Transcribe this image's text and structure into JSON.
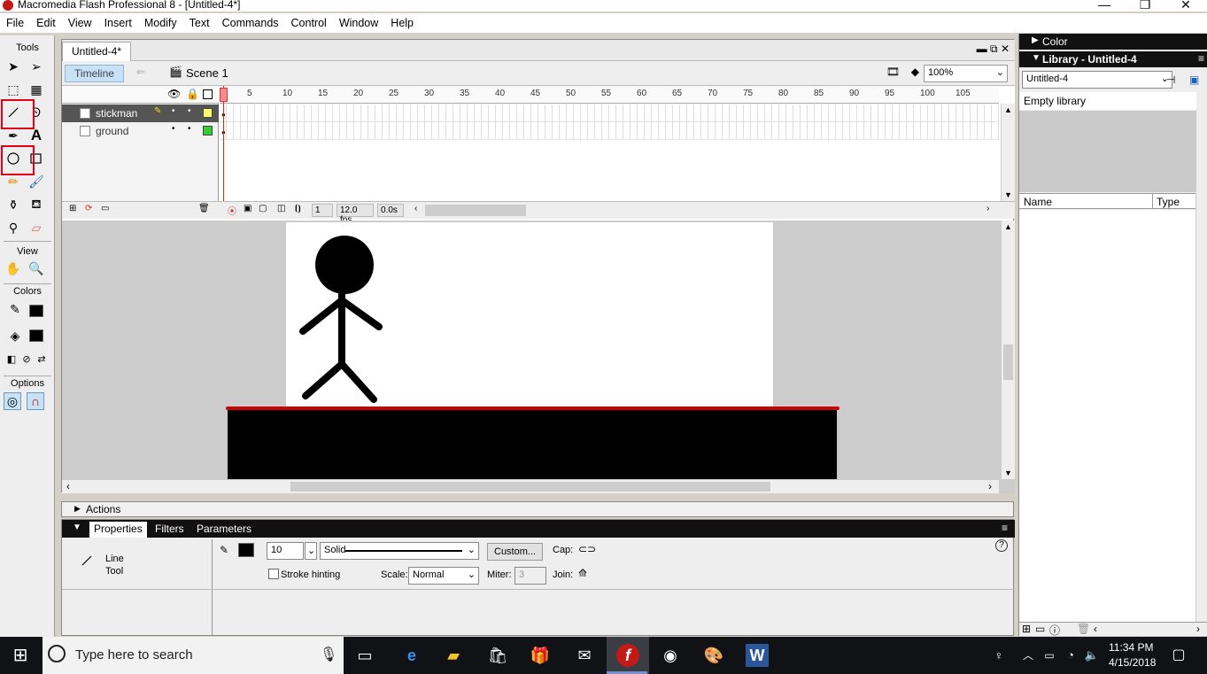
{
  "window": {
    "title": "Macromedia Flash Professional 8 - [Untitled-4*]"
  },
  "menu": [
    "File",
    "Edit",
    "View",
    "Insert",
    "Modify",
    "Text",
    "Commands",
    "Control",
    "Window",
    "Help"
  ],
  "tools": {
    "header": "Tools",
    "view_header": "View",
    "colors_header": "Colors",
    "options_header": "Options"
  },
  "document": {
    "tab": "Untitled-4*",
    "timeline_button": "Timeline",
    "scene": "Scene 1",
    "zoom": "100%"
  },
  "timeline": {
    "layers": [
      {
        "name": "stickman",
        "color": "#ffff66",
        "selected": true
      },
      {
        "name": "ground",
        "color": "#33cc33",
        "selected": false
      }
    ],
    "ruler": [
      "5",
      "10",
      "15",
      "20",
      "25",
      "30",
      "35",
      "40",
      "45",
      "50",
      "55",
      "60",
      "65",
      "70",
      "75",
      "80",
      "85",
      "90",
      "95",
      "100",
      "105"
    ],
    "current_frame": "1",
    "fps": "12.0 fps",
    "time": "0.0s"
  },
  "actions": {
    "label": "Actions"
  },
  "properties": {
    "tabs": [
      "Properties",
      "Filters",
      "Parameters"
    ],
    "tool_name_line1": "Line",
    "tool_name_line2": "Tool",
    "stroke_height": "10",
    "stroke_style": "Solid",
    "custom_button": "Custom...",
    "cap_label": "Cap:",
    "stroke_hinting": "Stroke hinting",
    "scale_label": "Scale:",
    "scale_value": "Normal",
    "miter_label": "Miter:",
    "miter_value": "3",
    "join_label": "Join:"
  },
  "panels": {
    "color": "Color",
    "library": "Library - Untitled-4",
    "library_select": "Untitled-4",
    "empty": "Empty library",
    "col_name": "Name",
    "col_type": "Type"
  },
  "taskbar": {
    "search_placeholder": "Type here to search",
    "time": "11:34 PM",
    "date": "4/15/2018"
  },
  "colors": {
    "stage": "#ffffff",
    "ground": "#000000",
    "ground_edge": "#cc0000",
    "highlight": "#e0001a"
  }
}
